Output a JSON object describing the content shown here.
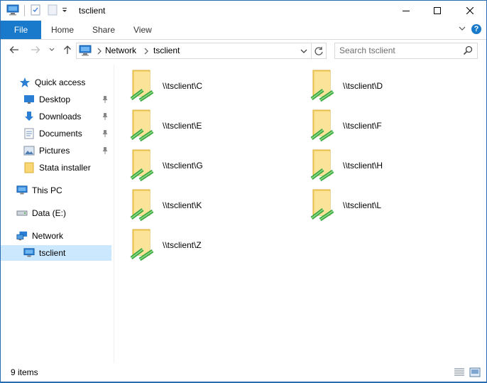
{
  "window": {
    "title": "tsclient"
  },
  "ribbon": {
    "file": "File",
    "tabs": [
      "Home",
      "Share",
      "View"
    ]
  },
  "address": {
    "crumbs": [
      "Network",
      "tsclient"
    ]
  },
  "search": {
    "placeholder": "Search tsclient"
  },
  "nav": {
    "quick_access": "Quick access",
    "quick_items": [
      "Desktop",
      "Downloads",
      "Documents",
      "Pictures",
      "Stata installer"
    ],
    "this_pc": "This PC",
    "data_drive": "Data (E:)",
    "network": "Network",
    "tsclient": "tsclient"
  },
  "items": [
    "\\\\tsclient\\C",
    "\\\\tsclient\\D",
    "\\\\tsclient\\E",
    "\\\\tsclient\\F",
    "\\\\tsclient\\G",
    "\\\\tsclient\\H",
    "\\\\tsclient\\K",
    "\\\\tsclient\\L",
    "\\\\tsclient\\Z"
  ],
  "status": {
    "count": "9 items"
  },
  "colors": {
    "accent": "#1979ca",
    "selected": "#cce8ff",
    "folder": "#f3c84f",
    "network": "#3fa83f"
  },
  "icons": {
    "folder": "network-folder-icon",
    "desktop": "desktop-icon",
    "downloads": "download-arrow-icon",
    "documents": "documents-icon",
    "pictures": "pictures-icon",
    "pin": "pin-icon"
  }
}
